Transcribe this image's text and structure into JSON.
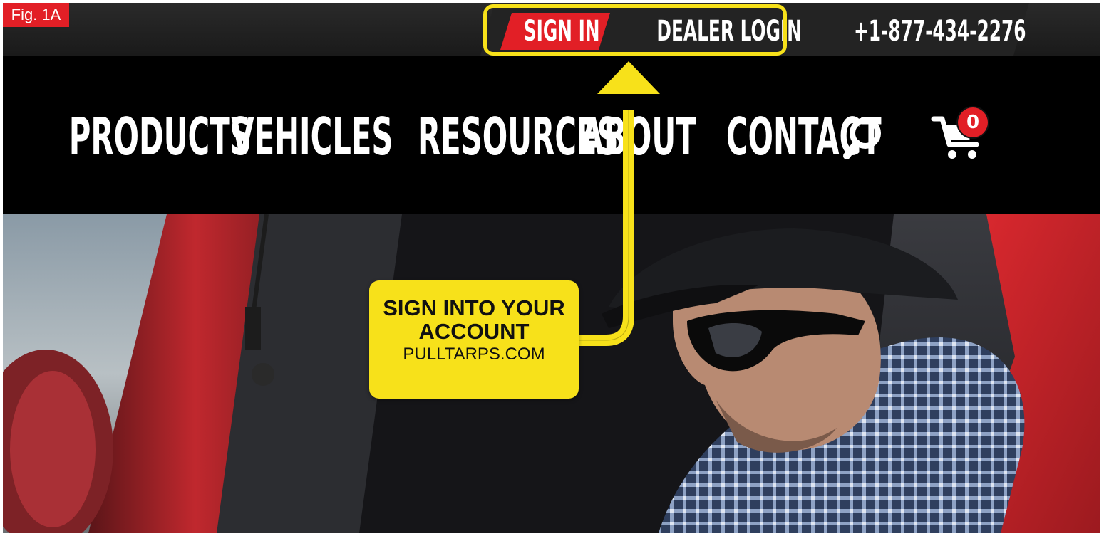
{
  "figure_label": "Fig. 1A",
  "utility_bar": {
    "sign_in": "SIGN IN",
    "dealer_login": "DEALER LOGIN",
    "phone": "+1-877-434-2276"
  },
  "nav": {
    "items": [
      {
        "label": "PRODUCTS"
      },
      {
        "label": "VEHICLES"
      },
      {
        "label": "RESOURCES"
      },
      {
        "label": "ABOUT"
      },
      {
        "label": "CONTACT"
      }
    ],
    "cart_count": "0"
  },
  "callout": {
    "title_line1": "SIGN INTO YOUR",
    "title_line2": "ACCOUNT",
    "subtitle": "PULLTARPS.COM"
  },
  "icons": {
    "search": "search-icon",
    "cart": "cart-icon"
  },
  "colors": {
    "brand_red": "#e21f26",
    "highlight_yellow": "#f7e11a",
    "bar_dark": "#1a1a1a",
    "nav_black": "#000000"
  }
}
